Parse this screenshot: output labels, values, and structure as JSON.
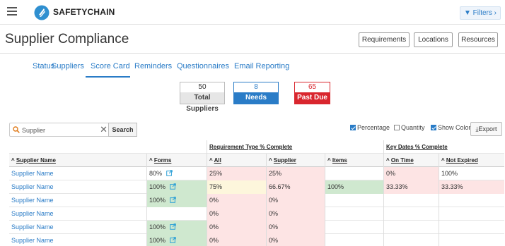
{
  "nav": {
    "brand_bold": "SAFETY",
    "brand_rest": "CHAIN",
    "filters_label": "Filters"
  },
  "header": {
    "title": "Supplier Compliance",
    "buttons": [
      "Requirements",
      "Locations",
      "Resources"
    ]
  },
  "tabs": [
    "Status",
    "Suppliers",
    "Score Card",
    "Reminders",
    "Questionnaires",
    "Email Reporting"
  ],
  "active_tab": "Score Card",
  "summary": [
    {
      "count": "50",
      "label": "Total Suppliers"
    },
    {
      "count": "8",
      "label": "Needs Approval"
    },
    {
      "count": "65",
      "label": "Past Due"
    }
  ],
  "search": {
    "value": "Supplier",
    "button": "Search"
  },
  "options": {
    "percentage": "Percentage",
    "quantity": "Quantity",
    "show_color": "Show Color",
    "export": "Export"
  },
  "groups": {
    "requirement": "Requirement Type % Complete",
    "key_dates": "Key Dates % Complete"
  },
  "columns": [
    "Supplier Name",
    "Forms",
    "All",
    "Supplier",
    "Items",
    "On Time",
    "Not Expired"
  ],
  "rows": [
    {
      "name": "Supplier Name",
      "forms": "80%",
      "all": "25%",
      "supplier": "25%",
      "items": "",
      "on_time": "0%",
      "not_expired": "100%"
    },
    {
      "name": "Supplier Name",
      "forms": "100%",
      "all": "75%",
      "supplier": "66.67%",
      "items": "100%",
      "on_time": "33.33%",
      "not_expired": "33.33%"
    },
    {
      "name": "Supplier Name",
      "forms": "100%",
      "all": "0%",
      "supplier": "0%",
      "items": "",
      "on_time": "",
      "not_expired": ""
    },
    {
      "name": "Supplier Name",
      "forms": "",
      "all": "0%",
      "supplier": "0%",
      "items": "",
      "on_time": "",
      "not_expired": ""
    },
    {
      "name": "Supplier Name",
      "forms": "100%",
      "all": "0%",
      "supplier": "0%",
      "items": "",
      "on_time": "",
      "not_expired": ""
    },
    {
      "name": "Supplier Name",
      "forms": "100%",
      "all": "0%",
      "supplier": "0%",
      "items": "",
      "on_time": "",
      "not_expired": ""
    }
  ],
  "colors": {
    "accent": "#2a7cc7",
    "danger": "#d9262e",
    "good": "#cfe8cf",
    "bad": "#fde4e4",
    "mid": "#fdf6dc"
  }
}
